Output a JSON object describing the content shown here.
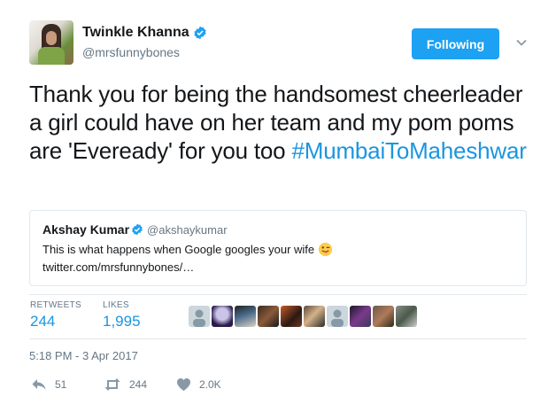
{
  "author": {
    "name": "Twinkle Khanna",
    "handle": "@mrsfunnybones"
  },
  "follow_button_label": "Following",
  "tweet": {
    "text": "Thank you for being the handsomest cheerleader a girl could have on her team and my pom poms are 'Eveready' for you too ",
    "hashtag": "#MumbaiToMaheshwar"
  },
  "quoted": {
    "name": "Akshay Kumar",
    "handle": "@akshaykumar",
    "text": "This is what happens when Google googles your wife",
    "link": "twitter.com/mrsfunnybones/…"
  },
  "stats": {
    "retweets_label": "RETWEETS",
    "retweets_value": "244",
    "likes_label": "LIKES",
    "likes_value": "1,995"
  },
  "timestamp": "5:18 PM - 3 Apr 2017",
  "actions": {
    "reply_count": "51",
    "retweet_count": "244",
    "like_count": "2.0K"
  },
  "colors": {
    "accent": "#1da1f2",
    "link": "#1b95e0",
    "muted": "#657786"
  }
}
